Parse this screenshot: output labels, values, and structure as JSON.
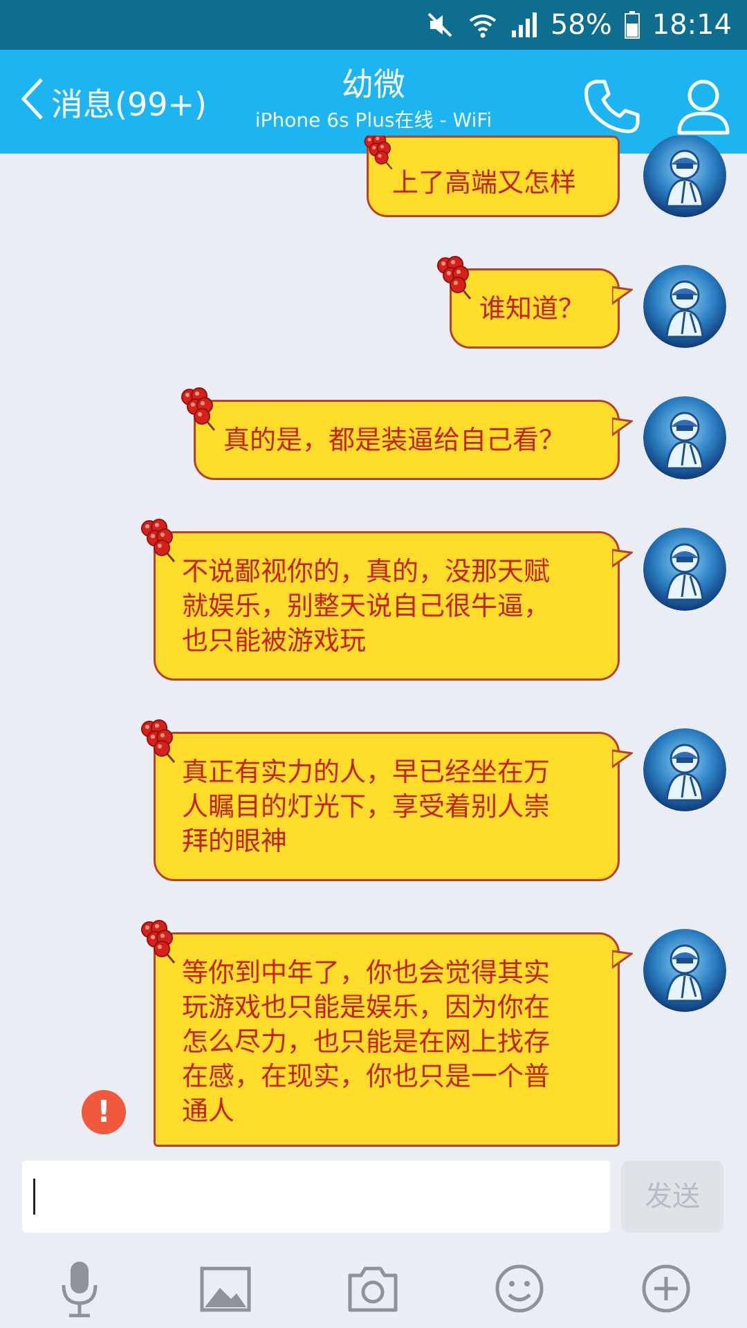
{
  "status_bar": {
    "battery": "58%",
    "time": "18:14"
  },
  "header": {
    "back_label": "消息(99+)",
    "title": "幼微",
    "subtitle": "iPhone 6s Plus在线 - WiFi"
  },
  "messages": [
    {
      "text": "上了高端又怎样"
    },
    {
      "text": "谁知道？"
    },
    {
      "text": "真的是，都是装逼给自己看？"
    },
    {
      "text": "不说鄙视你的，真的，没那天赋\n就娱乐，别整天说自己很牛逼，\n也只能被游戏玩"
    },
    {
      "text": "真正有实力的人，早已经坐在万\n人瞩目的灯光下，享受着别人崇\n拜的眼神"
    },
    {
      "text": "等你到中年了，你也会觉得其实\n玩游戏也只能是娱乐，因为你在\n怎么尽力，也只能是在网上找存\n在感，在现实，你也只是一个普\n通人"
    }
  ],
  "error_indicator": "!",
  "input": {
    "value": "",
    "send_label": "发送"
  },
  "toolbar_icons": [
    "microphone-icon",
    "image-icon",
    "camera-icon",
    "emoji-icon",
    "plus-icon"
  ],
  "colors": {
    "status_bar": "#0e6e8f",
    "title_bar": "#1db4f2",
    "bubble_fill": "#fddd2a",
    "bubble_border": "#b7412a",
    "bubble_text": "#c62212",
    "error": "#f0593e"
  }
}
